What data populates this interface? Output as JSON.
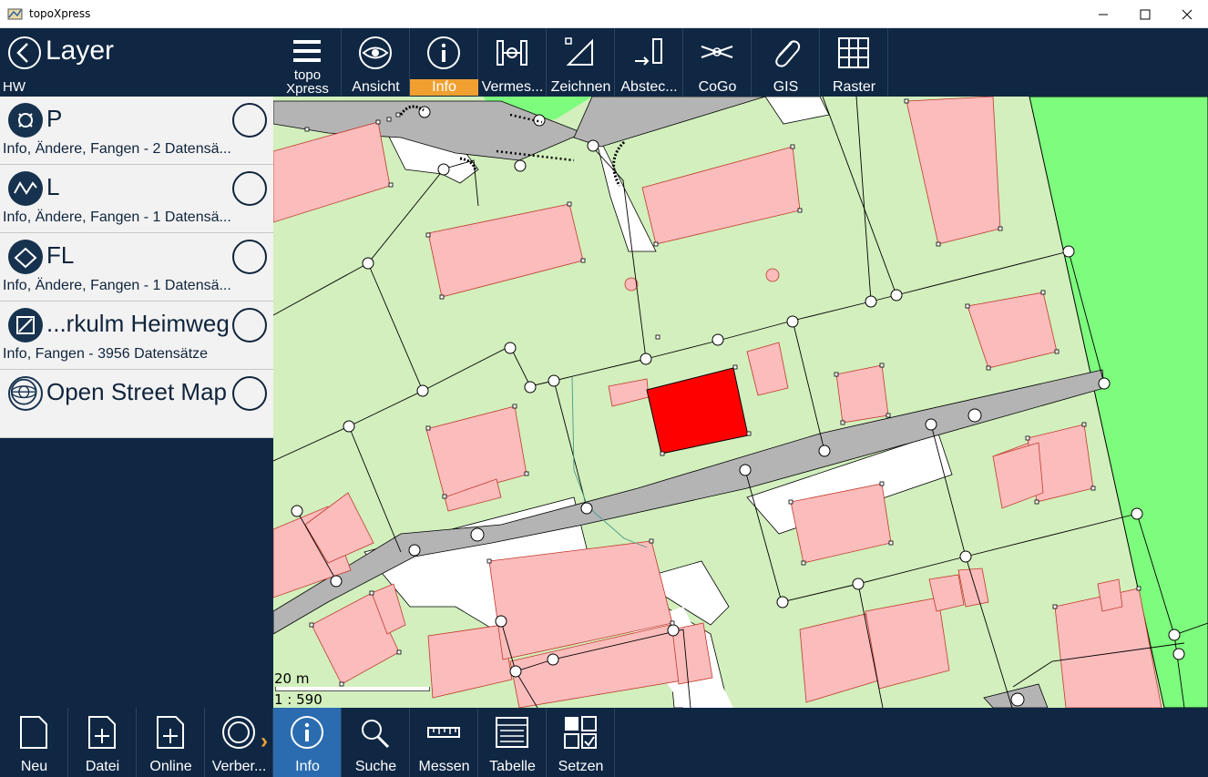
{
  "window": {
    "title": "topoXpress"
  },
  "left_panel": {
    "title": "Layer",
    "subtitle": "HW"
  },
  "layers": [
    {
      "name": "P",
      "desc": "Info, Ändere, Fangen  - 2 Datensä..."
    },
    {
      "name": "L",
      "desc": "Info, Ändere, Fangen  - 1 Datensä..."
    },
    {
      "name": "FL",
      "desc": "Info, Ändere, Fangen  - 1 Datensä..."
    },
    {
      "name": "...rkulm Heimweg",
      "desc": "Info, Fangen  - 3956 Datensätze"
    },
    {
      "name": "Open Street Map",
      "desc": ""
    }
  ],
  "top_toolbar": {
    "topo_line1": "topo",
    "topo_line2": "Xpress",
    "ansicht": "Ansicht",
    "info": "Info",
    "vermessung": "Vermes...",
    "zeichnen": "Zeichnen",
    "abstecken": "Abstec...",
    "cogo": "CoGo",
    "gis": "GIS",
    "raster": "Raster"
  },
  "map": {
    "scale_distance": "20 m",
    "scale_ratio": "1 : 590"
  },
  "bottom_toolbar": {
    "neu": "Neu",
    "datei": "Datei",
    "online": "Online",
    "verbergen": "Verber...",
    "info": "Info",
    "suche": "Suche",
    "messen": "Messen",
    "tabelle": "Tabelle",
    "setzen": "Setzen"
  },
  "colors": {
    "dark_bg": "#0f2743",
    "accent": "#f0a030",
    "active_bottom": "#2b6cb0",
    "parcel": "#d2efbd",
    "building": "#fbbcbc",
    "road": "#b4b4b4",
    "green_area": "#7dfc7d",
    "selected": "#ff0000"
  }
}
